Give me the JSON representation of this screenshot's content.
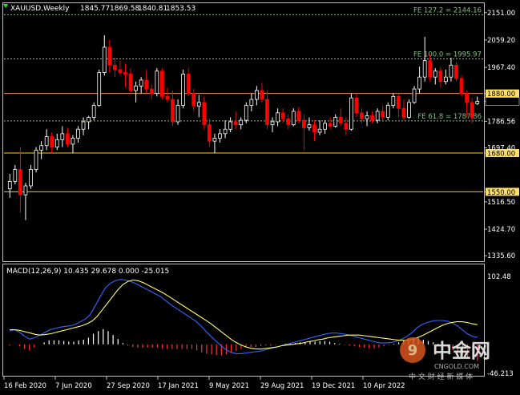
{
  "chart_data": [
    {
      "type": "candlestick",
      "symbol": "XAUUSD,Weekly",
      "ohlc_readout": [
        "1845.77",
        "1869.58",
        "1840.81",
        "1853.53"
      ],
      "last_price": "1853.53",
      "ylim": [
        1320,
        2180
      ],
      "y_ticks": [
        "2151.00",
        "2059.20",
        "1967.40",
        "1880.00",
        "1853.53",
        "1786.56",
        "1697.40",
        "1680.00",
        "1550.00",
        "1516.50",
        "1424.70",
        "1335.60"
      ],
      "x_ticks": [
        "16 Feb 2020",
        "7 Jun 2020",
        "27 Sep 2020",
        "17 Jan 2021",
        "9 May 2021",
        "29 Aug 2021",
        "19 Dec 2021",
        "10 Apr 2022"
      ],
      "levels": [
        {
          "label": "FE 127.2 = 2144.16",
          "value": 2144.16,
          "color": "#7fbf7f",
          "style": "dotted"
        },
        {
          "label": "FE 100.0 = 1995.97",
          "value": 1995.97,
          "color": "#7fbf7f",
          "style": "dotted"
        },
        {
          "label": "1880.00",
          "value": 1880.0,
          "color": "#e8925a",
          "style": "solid",
          "tag_bg": "#ffe066"
        },
        {
          "label": "FE 61.8 = 1787.86",
          "value": 1787.86,
          "color": "#7fbf7f",
          "style": "dotted"
        },
        {
          "label": "1680.00",
          "value": 1680.0,
          "color": "#ffcc00",
          "style": "solid",
          "tag_bg": "#ffe066"
        },
        {
          "label": "1550.00",
          "value": 1550.0,
          "color": "#ffcc00",
          "style": "solid",
          "tag_bg": "#ffe066"
        }
      ],
      "candles": [
        [
          1560,
          1610,
          1530,
          1585
        ],
        [
          1585,
          1640,
          1575,
          1625
        ],
        [
          1625,
          1700,
          1480,
          1540
        ],
        [
          1540,
          1580,
          1455,
          1570
        ],
        [
          1570,
          1640,
          1560,
          1625
        ],
        [
          1625,
          1700,
          1615,
          1690
        ],
        [
          1690,
          1720,
          1660,
          1705
        ],
        [
          1705,
          1760,
          1690,
          1735
        ],
        [
          1735,
          1750,
          1680,
          1700
        ],
        [
          1700,
          1745,
          1690,
          1725
        ],
        [
          1725,
          1770,
          1700,
          1745
        ],
        [
          1745,
          1765,
          1700,
          1710
        ],
        [
          1710,
          1740,
          1680,
          1730
        ],
        [
          1730,
          1770,
          1715,
          1760
        ],
        [
          1760,
          1800,
          1740,
          1785
        ],
        [
          1785,
          1805,
          1760,
          1800
        ],
        [
          1800,
          1850,
          1790,
          1840
        ],
        [
          1840,
          1960,
          1835,
          1950
        ],
        [
          1950,
          2075,
          1940,
          2035
        ],
        [
          2035,
          2060,
          1950,
          1975
        ],
        [
          1975,
          2000,
          1935,
          1960
        ],
        [
          1960,
          1990,
          1940,
          1950
        ],
        [
          1950,
          1980,
          1900,
          1945
        ],
        [
          1945,
          1965,
          1880,
          1890
        ],
        [
          1890,
          1920,
          1850,
          1905
        ],
        [
          1905,
          1935,
          1880,
          1925
        ],
        [
          1925,
          1960,
          1880,
          1895
        ],
        [
          1895,
          1910,
          1860,
          1880
        ],
        [
          1880,
          1965,
          1870,
          1955
        ],
        [
          1955,
          1965,
          1860,
          1870
        ],
        [
          1870,
          1900,
          1850,
          1860
        ],
        [
          1860,
          1890,
          1770,
          1785
        ],
        [
          1785,
          1860,
          1775,
          1840
        ],
        [
          1840,
          1960,
          1830,
          1945
        ],
        [
          1945,
          1965,
          1870,
          1880
        ],
        [
          1880,
          1895,
          1820,
          1838
        ],
        [
          1838,
          1875,
          1800,
          1850
        ],
        [
          1850,
          1870,
          1760,
          1775
        ],
        [
          1775,
          1795,
          1700,
          1720
        ],
        [
          1720,
          1745,
          1680,
          1730
        ],
        [
          1730,
          1760,
          1715,
          1745
        ],
        [
          1745,
          1790,
          1730,
          1760
        ],
        [
          1760,
          1800,
          1750,
          1785
        ],
        [
          1785,
          1820,
          1760,
          1775
        ],
        [
          1775,
          1800,
          1760,
          1790
        ],
        [
          1790,
          1850,
          1780,
          1840
        ],
        [
          1840,
          1880,
          1820,
          1860
        ],
        [
          1860,
          1905,
          1840,
          1890
        ],
        [
          1890,
          1915,
          1850,
          1860
        ],
        [
          1860,
          1890,
          1760,
          1775
        ],
        [
          1775,
          1800,
          1750,
          1785
        ],
        [
          1785,
          1830,
          1770,
          1815
        ],
        [
          1815,
          1830,
          1780,
          1795
        ],
        [
          1795,
          1810,
          1760,
          1775
        ],
        [
          1775,
          1830,
          1770,
          1820
        ],
        [
          1820,
          1835,
          1780,
          1790
        ],
        [
          1790,
          1810,
          1690,
          1765
        ],
        [
          1765,
          1800,
          1755,
          1775
        ],
        [
          1775,
          1790,
          1720,
          1750
        ],
        [
          1750,
          1790,
          1740,
          1760
        ],
        [
          1760,
          1790,
          1745,
          1780
        ],
        [
          1780,
          1800,
          1760,
          1770
        ],
        [
          1770,
          1810,
          1765,
          1800
        ],
        [
          1800,
          1830,
          1770,
          1780
        ],
        [
          1780,
          1800,
          1740,
          1760
        ],
        [
          1760,
          1880,
          1755,
          1865
        ],
        [
          1865,
          1880,
          1800,
          1815
        ],
        [
          1815,
          1830,
          1780,
          1795
        ],
        [
          1795,
          1820,
          1770,
          1805
        ],
        [
          1805,
          1820,
          1780,
          1790
        ],
        [
          1790,
          1830,
          1780,
          1820
        ],
        [
          1820,
          1840,
          1790,
          1800
        ],
        [
          1800,
          1850,
          1790,
          1840
        ],
        [
          1840,
          1880,
          1830,
          1870
        ],
        [
          1870,
          1880,
          1800,
          1830
        ],
        [
          1830,
          1860,
          1790,
          1800
        ],
        [
          1800,
          1860,
          1795,
          1850
        ],
        [
          1850,
          1905,
          1845,
          1895
        ],
        [
          1895,
          1970,
          1880,
          1935
        ],
        [
          1935,
          2070,
          1920,
          1990
        ],
        [
          1990,
          2010,
          1920,
          1935
        ],
        [
          1935,
          1965,
          1910,
          1955
        ],
        [
          1955,
          1970,
          1900,
          1920
        ],
        [
          1920,
          1960,
          1910,
          1935
        ],
        [
          1935,
          2000,
          1920,
          1975
        ],
        [
          1975,
          1985,
          1920,
          1930
        ],
        [
          1930,
          1940,
          1870,
          1880
        ],
        [
          1880,
          1890,
          1800,
          1850
        ],
        [
          1850,
          1865,
          1780,
          1800
        ],
        [
          1845.77,
          1869.58,
          1840.81,
          1853.53
        ]
      ],
      "candle_colors": {
        "up": "#ffffff",
        "down": "#ff0000",
        "wick": "#dddddd"
      }
    },
    {
      "type": "line+bar",
      "title": "MACD(12,26,9) 10.435 29.678 0.000 -25.015",
      "ylim": [
        -46.213,
        102.48
      ],
      "y_ticks": [
        "102.48",
        "-46.213"
      ],
      "macd_line": [
        20,
        22,
        18,
        12,
        8,
        10,
        14,
        18,
        22,
        24,
        26,
        27,
        28,
        30,
        34,
        38,
        45,
        58,
        72,
        85,
        92,
        96,
        98,
        97,
        95,
        92,
        88,
        84,
        80,
        76,
        72,
        66,
        60,
        55,
        50,
        45,
        40,
        35,
        28,
        20,
        12,
        5,
        -2,
        -8,
        -12,
        -14,
        -14,
        -13,
        -12,
        -11,
        -10,
        -8,
        -6,
        -4,
        -2,
        0,
        2,
        4,
        6,
        8,
        10,
        12,
        14,
        16,
        17,
        17,
        16,
        15,
        13,
        11,
        9,
        7,
        5,
        3,
        2,
        2,
        3,
        5,
        8,
        12,
        18,
        25,
        30,
        33,
        35,
        36,
        36,
        35,
        32,
        28,
        22,
        16,
        12,
        10.435
      ],
      "signal_line": [
        22,
        22,
        21,
        19,
        17,
        15,
        14,
        15,
        16,
        18,
        20,
        22,
        24,
        26,
        28,
        31,
        35,
        42,
        52,
        62,
        72,
        82,
        90,
        95,
        97,
        96,
        93,
        89,
        85,
        81,
        77,
        72,
        67,
        62,
        57,
        52,
        47,
        42,
        37,
        32,
        26,
        20,
        14,
        8,
        3,
        -1,
        -4,
        -6,
        -7,
        -7,
        -6,
        -5,
        -4,
        -2,
        -1,
        0,
        1,
        2,
        4,
        5,
        7,
        8,
        10,
        11,
        12,
        13,
        14,
        14,
        14,
        13,
        12,
        11,
        10,
        9,
        8,
        7,
        6,
        6,
        7,
        9,
        12,
        16,
        20,
        24,
        28,
        31,
        33,
        34,
        34,
        33,
        31,
        29.678
      ],
      "histogram": [
        -2,
        0,
        -3,
        -7,
        -9,
        -5,
        0,
        3,
        6,
        6,
        6,
        5,
        4,
        4,
        6,
        7,
        10,
        16,
        20,
        23,
        20,
        14,
        8,
        2,
        -2,
        -4,
        -5,
        -5,
        -5,
        -5,
        -5,
        -6,
        -7,
        -7,
        -7,
        -7,
        -7,
        -7,
        -9,
        -12,
        -14,
        -15,
        -16,
        -16,
        -15,
        -13,
        -10,
        -7,
        -5,
        -4,
        -4,
        -3,
        -2,
        -2,
        -1,
        0,
        1,
        2,
        2,
        3,
        3,
        4,
        4,
        5,
        5,
        4,
        2,
        1,
        -1,
        -2,
        -3,
        -4,
        -5,
        -6,
        -6,
        -5,
        -3,
        -1,
        1,
        3,
        6,
        9,
        10,
        9,
        7,
        5,
        3,
        1,
        -2,
        -5,
        -9,
        -13,
        -17,
        -20,
        -22,
        -25.015
      ],
      "colors": {
        "macd": "#3366ff",
        "signal": "#ffff66",
        "hist_up": "#ffffff",
        "hist_down": "#ff3333"
      }
    }
  ],
  "watermark": {
    "brand": "中金网",
    "domain": "CNGOLD.COM",
    "tagline": "中 文 财 经 新 媒 体"
  }
}
